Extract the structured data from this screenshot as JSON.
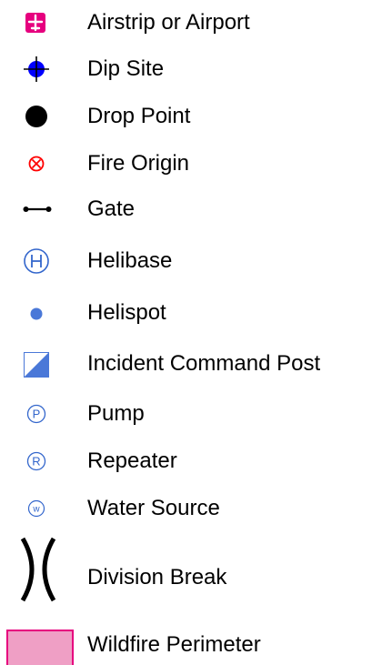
{
  "legend": {
    "items": [
      {
        "icon": "airplane-icon",
        "label": "Airstrip or Airport",
        "color": "#e6007e"
      },
      {
        "icon": "dip-site-crosshair-icon",
        "label": "Dip Site",
        "color": "#0000ff"
      },
      {
        "icon": "filled-circle-icon",
        "label": "Drop Point",
        "color": "#000000"
      },
      {
        "icon": "circled-x-icon",
        "label": "Fire Origin",
        "color": "#ff0000"
      },
      {
        "icon": "gate-icon",
        "label": "Gate",
        "color": "#000000"
      },
      {
        "icon": "circled-h-icon",
        "label": "Helibase",
        "color": "#3366cc"
      },
      {
        "icon": "small-dot-icon",
        "label": "Helispot",
        "color": "#4a78d8"
      },
      {
        "icon": "half-filled-square-icon",
        "label": "Incident Command Post",
        "color": "#4a78d8"
      },
      {
        "icon": "circled-p-icon",
        "label": "Pump",
        "color": "#3366cc",
        "glyph": "P"
      },
      {
        "icon": "circled-r-icon",
        "label": "Repeater",
        "color": "#3366cc",
        "glyph": "R"
      },
      {
        "icon": "circled-w-icon",
        "label": "Water Source",
        "color": "#3366cc",
        "glyph": "w"
      },
      {
        "icon": "division-break-icon",
        "label": "Division Break",
        "color": "#000000"
      },
      {
        "icon": "perimeter-swatch-icon",
        "label": "Wildfire Perimeter",
        "color": "#ef9fc5",
        "border": "#e6007e"
      }
    ]
  }
}
